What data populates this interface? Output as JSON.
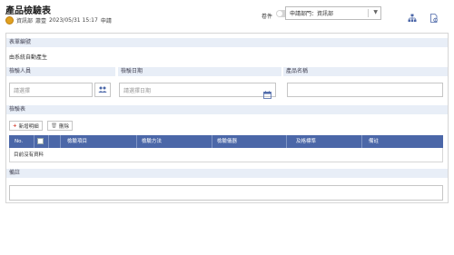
{
  "header": {
    "title": "產品檢驗表",
    "meta_dept": "資訊部",
    "meta_user": "蕭壹",
    "meta_datetime": "2023/05/31 15:17",
    "meta_status": "申請",
    "toggle_label": "卷件",
    "department_select": "申請部門：資訊部",
    "icons": [
      "org-chart-icon",
      "document-settings-icon"
    ]
  },
  "form": {
    "form_no_label": "表單編號",
    "form_no_value": "由系統自動產生",
    "inspector_label": "檢驗人員",
    "inspector_placeholder": "請選擇",
    "date_label": "檢驗日期",
    "date_placeholder": "請選擇日期",
    "product_label": "產品名稱",
    "product_value": ""
  },
  "inspection": {
    "section_label": "檢驗表",
    "add_button": "新增明細",
    "delete_button": "刪除",
    "columns": [
      "No.",
      "",
      "",
      "檢驗項目",
      "檢驗方法",
      "檢驗儀器",
      "及格標準",
      "備註"
    ],
    "empty_text": "目前沒有資料"
  },
  "remarks": {
    "label": "備註",
    "value": ""
  },
  "colors": {
    "table_header": "#4b67a8",
    "section_header": "#e8eef7",
    "add_icon": "#d43a2a"
  }
}
